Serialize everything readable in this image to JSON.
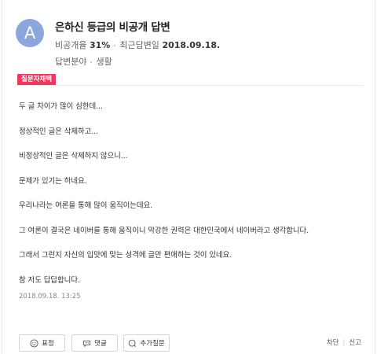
{
  "question": {
    "avatar_letter": "A",
    "title": "은하신 등급의 비공개 답변",
    "rate_label": "비공개율",
    "rate_value": "31%",
    "recent_label": "최근답변일",
    "recent_value": "2018.09.18.",
    "field_label": "답변분야",
    "field_value": "생활",
    "avatar_color": "#8ba5dd"
  },
  "badge": {
    "label": "질문자채택",
    "color": "#f0375d"
  },
  "answer": {
    "paragraphs": [
      "두 글 차이가 많이 심한데...",
      "정상적인 글은 삭제하고...",
      "비정상적인 글은 삭제하지 않으니...",
      "문제가 있기는 하네요.",
      "우리나라는 여론을 통해 많이 움직이는데요.",
      "그 여론이 결국은 네이버를 통해 움직이니 막강한 권력은 대한민국에서 네이버라고 생각합니다.",
      "그래서 그런지 자신의 입맛에 맞는 성격에 글만 편애하는 것이 있네요.",
      "참 저도 답답합니다."
    ],
    "date": "2018.09.18. 13:25"
  },
  "actions": {
    "react_label": "표정",
    "comment_label": "댓글",
    "more_label": "추가질문",
    "block_label": "차단",
    "report_label": "신고"
  },
  "icons": [
    "smile-icon",
    "speech-bubble-icon",
    "question-bubble-icon"
  ]
}
